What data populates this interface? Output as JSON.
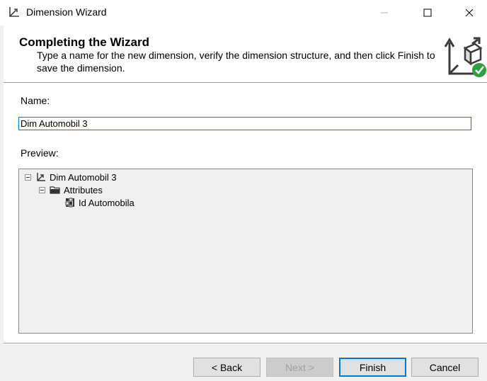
{
  "window": {
    "title": "Dimension Wizard",
    "app_icon": "dimension-icon",
    "controls": [
      "minimize-icon",
      "maximize-icon",
      "close-icon"
    ]
  },
  "header": {
    "title": "Completing the Wizard",
    "description": "Type a name for the new dimension, verify the dimension structure, and then click Finish to save the dimension.",
    "icon": "dimension-cube-check-icon"
  },
  "form": {
    "name_label": "Name:",
    "name_value": "Dim Automobil 3",
    "preview_label": "Preview:"
  },
  "tree": {
    "root": {
      "label": "Dim Automobil 3",
      "icon": "dimension-icon",
      "expanded": true
    },
    "folder": {
      "label": "Attributes",
      "icon": "folder-icon",
      "expanded": true
    },
    "attribute": {
      "label": "Id Automobila",
      "icon": "attribute-icon"
    }
  },
  "buttons": {
    "back": "< Back",
    "next": "Next >",
    "finish": "Finish",
    "cancel": "Cancel"
  },
  "colors": {
    "accent": "#0078d7",
    "check": "#2e9e3f"
  }
}
